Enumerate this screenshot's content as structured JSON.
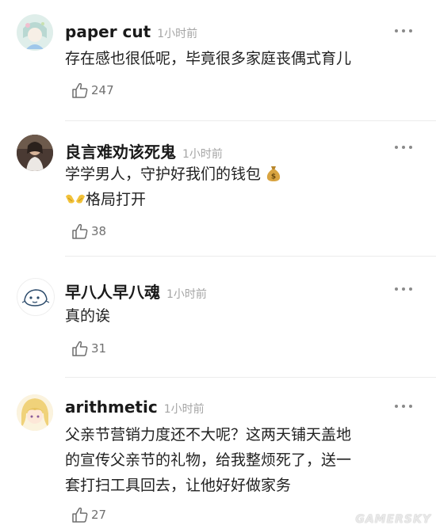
{
  "comments": [
    {
      "username": "paper cut",
      "time": "1小时前",
      "lines": [
        "存在感也很低呢，毕竟很多家庭丧偶式育儿"
      ],
      "likes": "247",
      "avatar_icon": "anime-girl-avatar"
    },
    {
      "username": "良言难劝该死鬼",
      "time": "1小时前",
      "lines": [
        "学学男人，守护好我们的钱包",
        "格局打开"
      ],
      "emoji": [
        "money-bag-emoji",
        "open-hands-emoji"
      ],
      "likes": "38",
      "avatar_icon": "photo-avatar"
    },
    {
      "username": "早八人早八魂",
      "time": "1小时前",
      "lines": [
        "真的诶"
      ],
      "likes": "31",
      "avatar_icon": "sketch-avatar"
    },
    {
      "username": "arithmetic",
      "time": "1小时前",
      "lines": [
        "父亲节营销力度还不大呢？这两天铺天盖地",
        "的宣传父亲节的礼物，给我整烦死了，送一",
        "套打扫工具回去，让他好好做家务"
      ],
      "likes": "27",
      "avatar_icon": "blonde-anime-avatar"
    }
  ],
  "watermark": "GAMERSKY",
  "colors": {
    "text": "#1a1a1a",
    "muted": "#a5a5a5",
    "divider": "#ececec"
  }
}
